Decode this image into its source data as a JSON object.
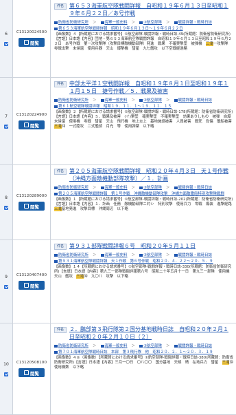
{
  "rows": [
    {
      "number": "6",
      "ref_code": "C13120024500",
      "view_label": "閲覧",
      "badge": "件名",
      "title": "第６５３海軍航空隊戦闘詳報　自昭和１９年６月１３日至昭和１９年６月２２日／あ号作戦",
      "breadcrumbs": [
        "防衛省防衛研究所",
        "海軍一般史料",
        "③航空部隊",
        "戦闘詳報・戦時日誌"
      ],
      "subref": "第６５３海軍航空隊戦闘詳報　昭和１９年６月１３日～１９年６月２２日",
      "text_before": "【画像数】４【所蔵館における請求番号】①航空部隊-戦闘詳報・戦時日誌-49(所蔵館：防衛省防衛研究所)【言語】日本語【内容】団地・第６５３海軍航空隊戦闘詳報　自昭和１９年６月１３日至昭和１９年６月２２日　あ号作戦　第一次攻撃隊（攻撃目標敵機動部隊）発進　戦果　不確実撃墜　被弾機　",
      "highlight": "三滝",
      "text_after": "一攻撃隊　零戦出撃　未帰還　使用兵器　天山　爆撃機　彗星　九七艦攻　以下空戦経過略"
    },
    {
      "number": "7",
      "ref_code": "C13120224900",
      "view_label": "閲覧",
      "badge": "件名",
      "title": "中部太平洋１空戦闘詳報　自昭和１９年８月１日至昭和１９年１１月１５日　捷号作戦／５．戦果及被害",
      "breadcrumbs": [
        "防衛省防衛研究所",
        "海軍一般史料",
        "③航空部隊",
        "戦闘詳報・戦時日誌"
      ],
      "subref": "第６１航空戦隊戦闘詳報　昭和１９．１１．１～１９．１１．１５",
      "text_before": "【画像数】２【所蔵館における請求番号】①航空部隊-戦闘詳報・戦時日誌-178(所蔵館：防衛省防衛研究所)【言語】日本語【内容】５．戦果及被害　(イ)撃墜　確実撃墜　不確実撃墜　効果ありしもの　被弾　自爆　未帰還　使用機　零戦　彗星　天山　飛行機　地上炎上　基地施設被害　人員被害　戦死　負傷　艦船被害　",
      "highlight": "三滝",
      "text_after": "沖　一式陸攻　二式艦偵　月光　等　使用弾薬　以下略"
    },
    {
      "number": "8",
      "ref_code": "C13120289000",
      "view_label": "閲覧",
      "badge": "件名",
      "title": "第２０５海軍航空隊戦闘詳報　昭和２０年４月３日　天１号作戦（沖縄方面敵機動部隊攻撃）／１．計画",
      "breadcrumbs": [
        "防衛省防衛研究所",
        "海軍一般史料",
        "③航空部隊",
        "戦闘詳報・戦時日誌"
      ],
      "subref": "第２０５海軍航空隊戦闘詳報　第１号作戦　沖縄敵機動部隊攻撃　沖縄方面敵艦船特別攻撃隊戦闘",
      "text_before": "【画像数】１【所蔵館における請求番号】①航空部隊-戦闘詳報・戦時日誌-202(所蔵館：防衛省防衛研究所)【言語】日本語【内容】１．計画　任務　敵機動部隊ニ対シ　特別攻撃　使用兵力　零戦　爆装　進撃経路　",
      "highlight": "三滝",
      "text_after": "基地発進　攻撃目標　沖縄周辺　以下略"
    },
    {
      "number": "9",
      "ref_code": "C13120407400",
      "view_label": "閲覧",
      "badge": "件名",
      "title": "第９３１部隊戦闘詳報６号　昭和２０年５月１１日",
      "breadcrumbs": [
        "防衛省防衛研究所",
        "海軍一般史料",
        "③航空部隊",
        "戦闘詳報・戦時日誌"
      ],
      "subref": "第９３１海軍航空隊戦闘詳報　天１作戦　第６号作戦　昭和２０．４．２２～２０．５．９",
      "text_before": "【画像数】１４【所蔵館における請求番号】①航空部隊-戦闘詳報・戦時日誌-330(所蔵館：防衛省防衛研究所)【言語】日本語【内容】第九三一部隊戦闘詳報第六号　昭和二十年五月十一日　第九三一部隊　使用機　天山　艦攻　",
      "highlight": "三滝",
      "text_after": "沖　九〇八　攻撃　以下略"
    },
    {
      "number": "10",
      "ref_code": "C13120508100",
      "view_label": "閲覧",
      "badge": "件名",
      "title": "２．鵬部第３飛行隊第２国分基地戦時日誌　自昭和２０年２月１日至昭和２０年２月１０日（２）",
      "breadcrumbs": [
        "防衛省防衛研究所",
        "海軍一般史料",
        "③航空部隊",
        "戦闘詳報・戦時日誌"
      ],
      "subref": "第７０１海軍航空隊戦時日誌　本部　第３飛行隊　他　昭和２０．２．１～２０．３．１９",
      "text_before": "【画像数】４８（画像数）【所蔵館における請求番号】①航空部隊-戦闘詳報・戦時日誌-380(所蔵館：防衛省防衛研究所)【言語】日本語【内容】三月一〇日　〇八〇〇　国分基地　天候　晴　在地兵力　彗星　",
      "highlight": "三滝",
      "text_after": "沖　使用機数　以下略"
    }
  ]
}
